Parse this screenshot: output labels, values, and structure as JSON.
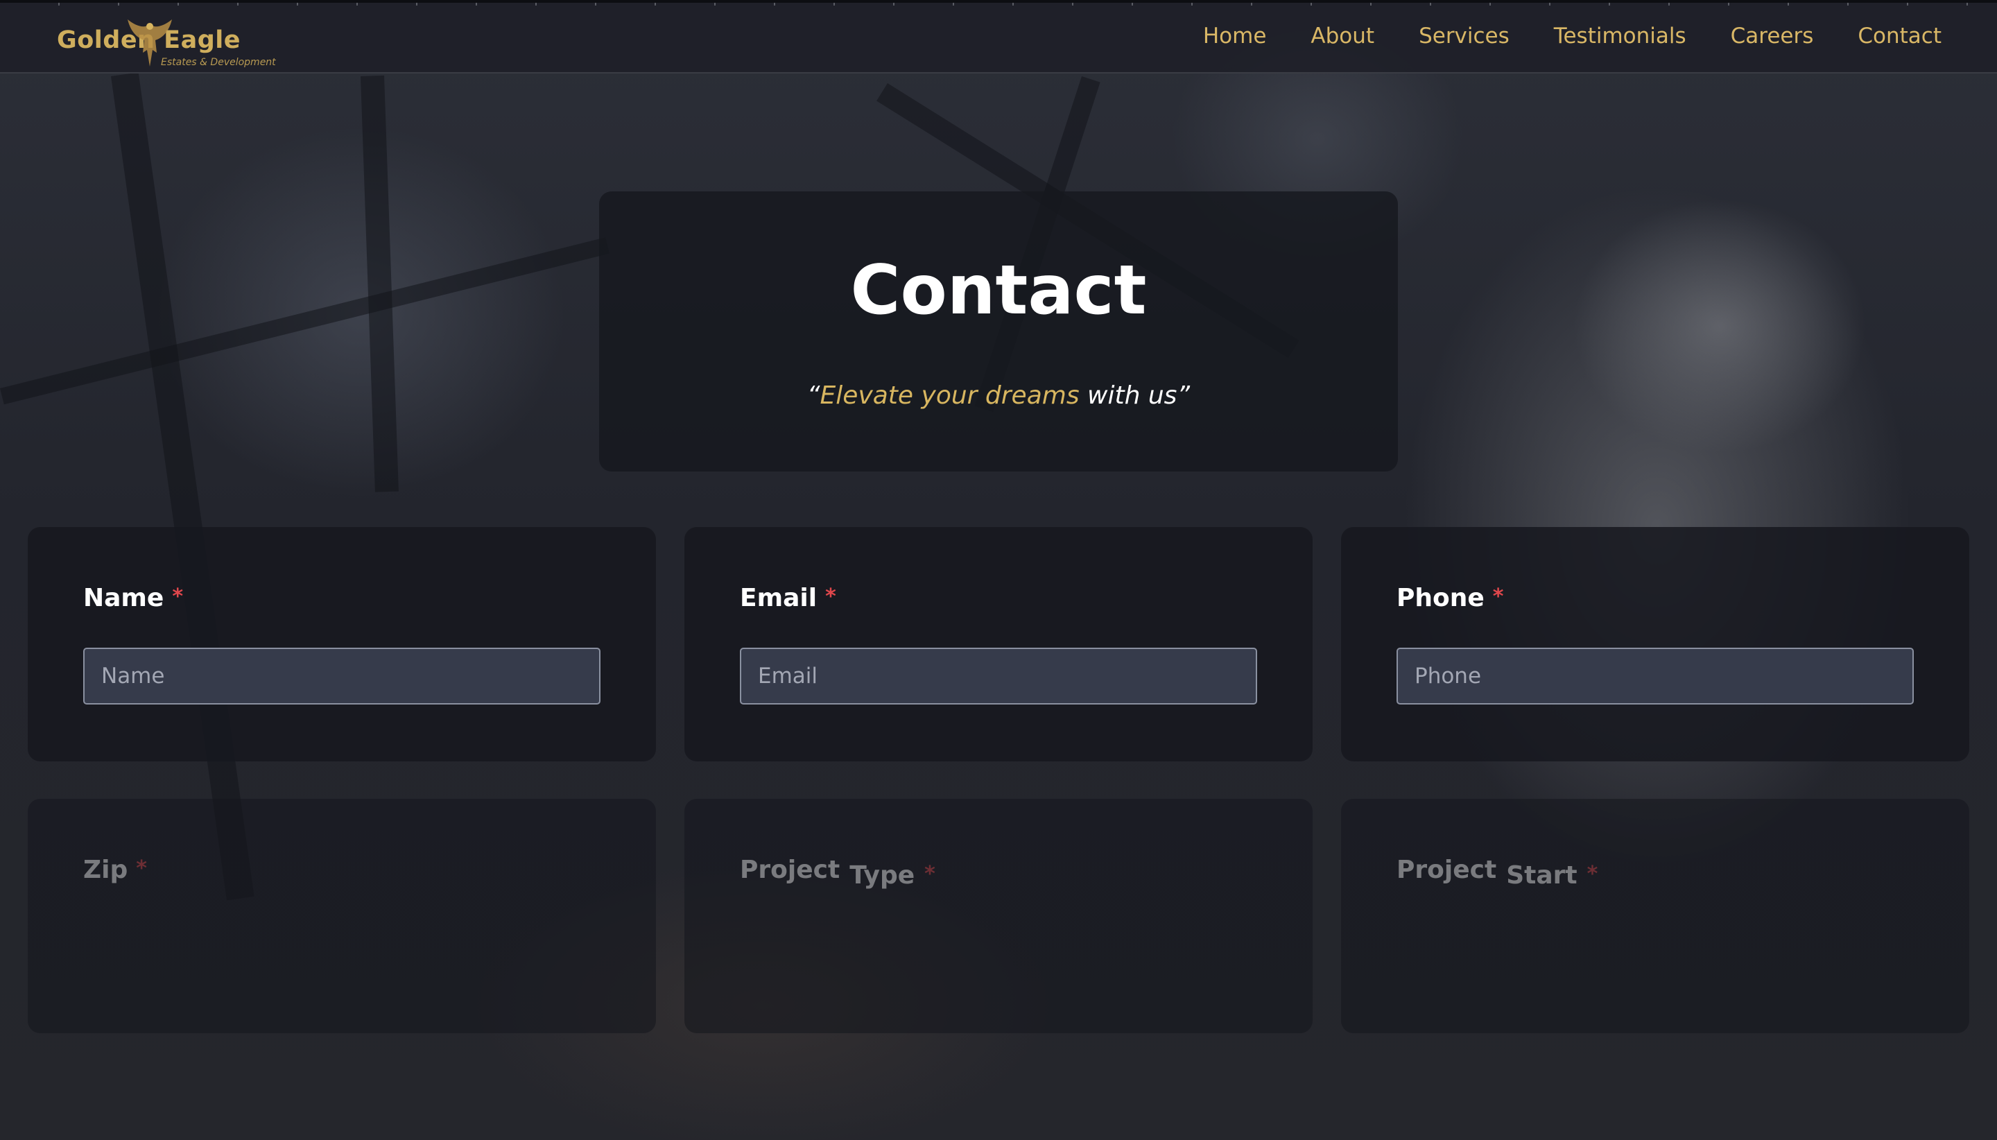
{
  "header": {
    "logo_text": "Golden Eagle",
    "logo_subtitle": "Estates & Development",
    "nav": [
      "Home",
      "About",
      "Services",
      "Testimonials",
      "Careers",
      "Contact"
    ]
  },
  "hero": {
    "title": "Contact",
    "tagline_open": "“",
    "tagline_highlight": "Elevate your dreams",
    "tagline_rest": " with us”"
  },
  "form": {
    "name": {
      "label": "Name",
      "required": "*",
      "placeholder": "Name"
    },
    "email": {
      "label": "Email",
      "required": "*",
      "placeholder": "Email"
    },
    "phone": {
      "label": "Phone",
      "required": "*",
      "placeholder": "Phone"
    },
    "zip": {
      "label": "Zip",
      "required": "*"
    },
    "project_type": {
      "label_a": "Project",
      "label_b": "Type",
      "required": "*"
    },
    "project_start": {
      "label_a": "Project",
      "label_b": "Start",
      "required": "*"
    }
  },
  "colors": {
    "accent_gold": "#d8b660",
    "required_red": "#e0474c",
    "card_bg": "#16181e"
  }
}
